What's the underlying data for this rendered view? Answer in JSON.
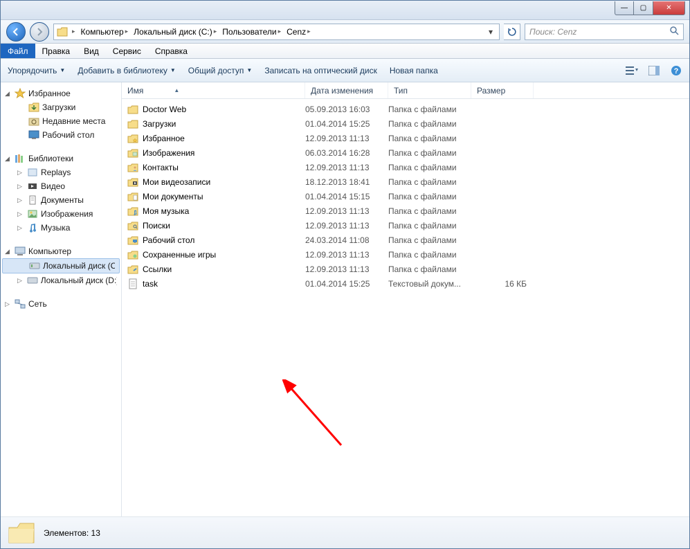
{
  "window_controls": {
    "min": "—",
    "max": "▢",
    "close": "✕"
  },
  "breadcrumbs": [
    {
      "label": "Компьютер"
    },
    {
      "label": "Локальный диск (C:)"
    },
    {
      "label": "Пользователи"
    },
    {
      "label": "Cenz"
    }
  ],
  "search": {
    "placeholder": "Поиск: Cenz"
  },
  "menubar": [
    {
      "key": "file",
      "label": "Файл",
      "active": true
    },
    {
      "key": "edit",
      "label": "Правка"
    },
    {
      "key": "view",
      "label": "Вид"
    },
    {
      "key": "tools",
      "label": "Сервис"
    },
    {
      "key": "help",
      "label": "Справка"
    }
  ],
  "toolbar": {
    "organize": "Упорядочить",
    "library": "Добавить в библиотеку",
    "share": "Общий доступ",
    "burn": "Записать на оптический диск",
    "newfolder": "Новая папка"
  },
  "columns": {
    "name": "Имя",
    "date": "Дата изменения",
    "type": "Тип",
    "size": "Размер"
  },
  "sidebar": {
    "favorites": {
      "label": "Избранное",
      "items": [
        {
          "key": "downloads",
          "label": "Загрузки"
        },
        {
          "key": "recent",
          "label": "Недавние места"
        },
        {
          "key": "desktop",
          "label": "Рабочий стол"
        }
      ]
    },
    "libraries": {
      "label": "Библиотеки",
      "items": [
        {
          "key": "replays",
          "label": "Replays"
        },
        {
          "key": "videos",
          "label": "Видео"
        },
        {
          "key": "documents",
          "label": "Документы"
        },
        {
          "key": "pictures",
          "label": "Изображения"
        },
        {
          "key": "music",
          "label": "Музыка"
        }
      ]
    },
    "computer": {
      "label": "Компьютер",
      "items": [
        {
          "key": "diskc",
          "label": "Локальный диск (C:)",
          "selected": true
        },
        {
          "key": "diskd",
          "label": "Локальный диск (D:)"
        }
      ]
    },
    "network": {
      "label": "Сеть"
    }
  },
  "files": [
    {
      "name": "Doctor Web",
      "date": "05.09.2013 16:03",
      "type": "Папка с файлами",
      "size": "",
      "icon": "folder"
    },
    {
      "name": "Загрузки",
      "date": "01.04.2014 15:25",
      "type": "Папка с файлами",
      "size": "",
      "icon": "folder"
    },
    {
      "name": "Избранное",
      "date": "12.09.2013 11:13",
      "type": "Папка с файлами",
      "size": "",
      "icon": "folder-star"
    },
    {
      "name": "Изображения",
      "date": "06.03.2014 16:28",
      "type": "Папка с файлами",
      "size": "",
      "icon": "folder-pic"
    },
    {
      "name": "Контакты",
      "date": "12.09.2013 11:13",
      "type": "Папка с файлами",
      "size": "",
      "icon": "folder-contacts"
    },
    {
      "name": "Мои видеозаписи",
      "date": "18.12.2013 18:41",
      "type": "Папка с файлами",
      "size": "",
      "icon": "folder-video"
    },
    {
      "name": "Мои документы",
      "date": "01.04.2014 15:15",
      "type": "Папка с файлами",
      "size": "",
      "icon": "folder-doc"
    },
    {
      "name": "Моя музыка",
      "date": "12.09.2013 11:13",
      "type": "Папка с файлами",
      "size": "",
      "icon": "folder-music"
    },
    {
      "name": "Поиски",
      "date": "12.09.2013 11:13",
      "type": "Папка с файлами",
      "size": "",
      "icon": "folder-search"
    },
    {
      "name": "Рабочий стол",
      "date": "24.03.2014 11:08",
      "type": "Папка с файлами",
      "size": "",
      "icon": "folder-desktop"
    },
    {
      "name": "Сохраненные игры",
      "date": "12.09.2013 11:13",
      "type": "Папка с файлами",
      "size": "",
      "icon": "folder-games"
    },
    {
      "name": "Ссылки",
      "date": "12.09.2013 11:13",
      "type": "Папка с файлами",
      "size": "",
      "icon": "folder-links"
    },
    {
      "name": "task",
      "date": "01.04.2014 15:25",
      "type": "Текстовый докум...",
      "size": "16 КБ",
      "icon": "textfile"
    }
  ],
  "status": {
    "label": "Элементов: 13"
  }
}
